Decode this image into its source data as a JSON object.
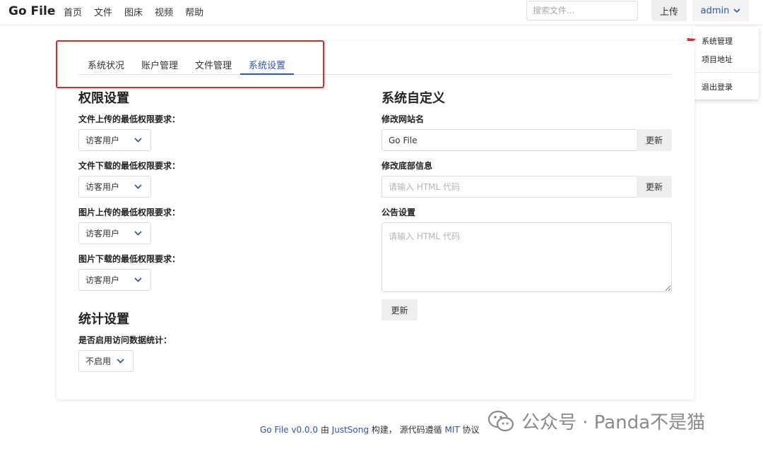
{
  "navbar": {
    "brand": "Go File",
    "links": [
      "首页",
      "文件",
      "图床",
      "视频",
      "帮助"
    ],
    "search_placeholder": "搜索文件...",
    "upload_label": "上传",
    "user_label": "admin"
  },
  "user_menu": {
    "items": [
      "系统管理",
      "项目地址",
      "退出登录"
    ]
  },
  "tabs": [
    "系统状况",
    "账户管理",
    "文件管理",
    "系统设置"
  ],
  "active_tab": "系统设置",
  "permission": {
    "title": "权限设置",
    "fields": [
      {
        "label": "文件上传的最低权限要求：",
        "value": "访客用户"
      },
      {
        "label": "文件下载的最低权限要求：",
        "value": "访客用户"
      },
      {
        "label": "图片上传的最低权限要求：",
        "value": "访客用户"
      },
      {
        "label": "图片下载的最低权限要求：",
        "value": "访客用户"
      }
    ]
  },
  "stats": {
    "title": "统计设置",
    "label": "是否启用访问数据统计：",
    "value": "不启用"
  },
  "custom": {
    "title": "系统自定义",
    "site_name_label": "修改网站名",
    "site_name_value": "Go File",
    "footer_label": "修改底部信息",
    "footer_placeholder": "请输入 HTML 代码",
    "notice_label": "公告设置",
    "notice_placeholder": "请输入 HTML 代码",
    "update_label": "更新"
  },
  "footer": {
    "app": "Go File v0.0.0",
    "by": "由",
    "author": "JustSong",
    "built": "构建，",
    "license_prefix": "源代码遵循",
    "license": "MIT",
    "license_suffix": "协议"
  },
  "watermark": "公众号 · Panda不是猫",
  "colors": {
    "accent": "#2f55a4",
    "annotation": "#e5242b"
  }
}
